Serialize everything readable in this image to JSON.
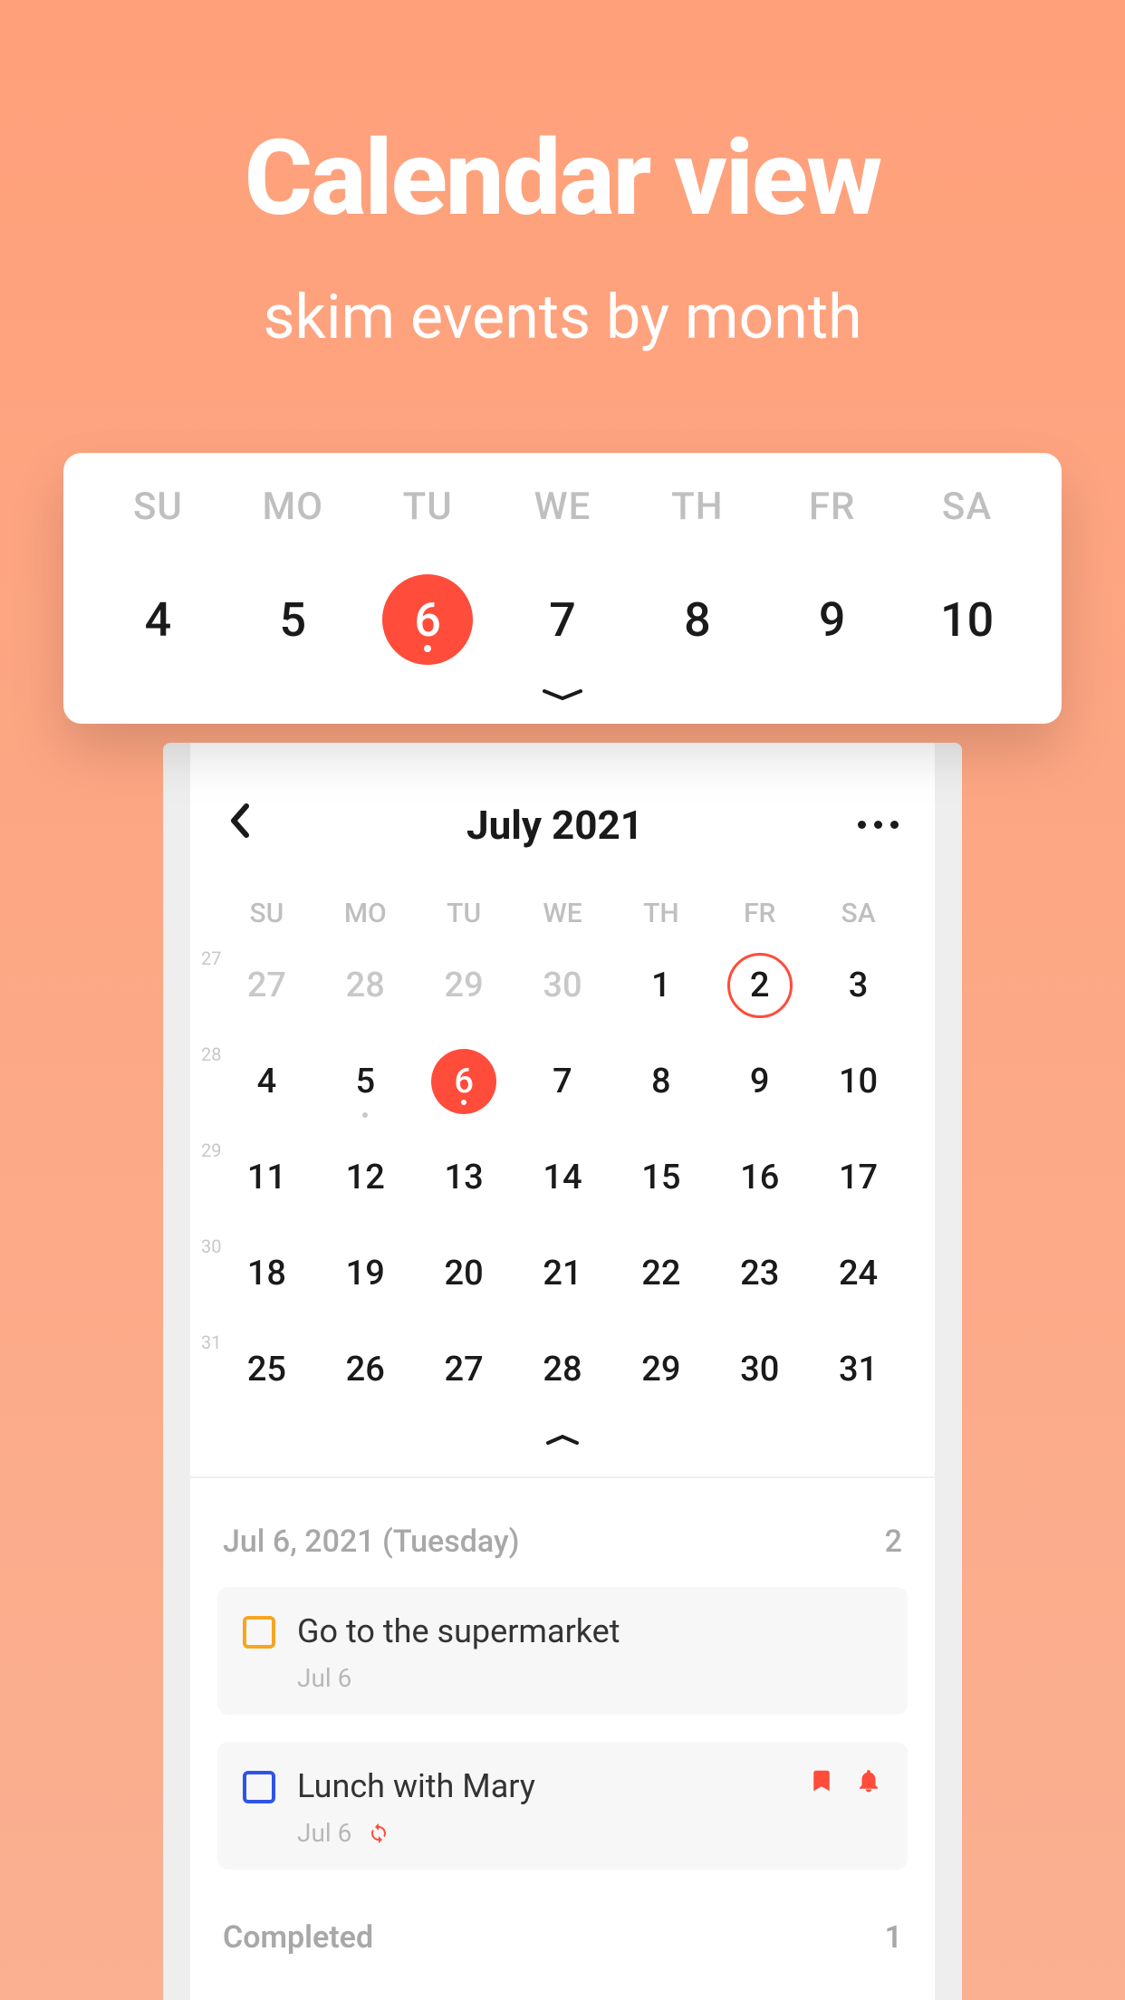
{
  "hero": {
    "title": "Calendar view",
    "subtitle": "skim events by month"
  },
  "week_card": {
    "dow": [
      "SU",
      "MO",
      "TU",
      "WE",
      "TH",
      "FR",
      "SA"
    ],
    "days": [
      {
        "n": "4"
      },
      {
        "n": "5"
      },
      {
        "n": "6",
        "today": true
      },
      {
        "n": "7"
      },
      {
        "n": "8"
      },
      {
        "n": "9"
      },
      {
        "n": "10"
      }
    ]
  },
  "month": {
    "title": "July 2021",
    "dow": [
      "SU",
      "MO",
      "TU",
      "WE",
      "TH",
      "FR",
      "SA"
    ],
    "weeks": [
      {
        "wn": "27",
        "cells": [
          {
            "n": "27",
            "dim": true
          },
          {
            "n": "28",
            "dim": true
          },
          {
            "n": "29",
            "dim": true
          },
          {
            "n": "30",
            "dim": true
          },
          {
            "n": "1"
          },
          {
            "n": "2",
            "ring": true
          },
          {
            "n": "3"
          }
        ]
      },
      {
        "wn": "28",
        "cells": [
          {
            "n": "4"
          },
          {
            "n": "5",
            "dot": true
          },
          {
            "n": "6",
            "today": true
          },
          {
            "n": "7"
          },
          {
            "n": "8"
          },
          {
            "n": "9"
          },
          {
            "n": "10"
          }
        ]
      },
      {
        "wn": "29",
        "cells": [
          {
            "n": "11"
          },
          {
            "n": "12"
          },
          {
            "n": "13"
          },
          {
            "n": "14"
          },
          {
            "n": "15"
          },
          {
            "n": "16"
          },
          {
            "n": "17"
          }
        ]
      },
      {
        "wn": "30",
        "cells": [
          {
            "n": "18"
          },
          {
            "n": "19"
          },
          {
            "n": "20"
          },
          {
            "n": "21"
          },
          {
            "n": "22"
          },
          {
            "n": "23"
          },
          {
            "n": "24"
          }
        ]
      },
      {
        "wn": "31",
        "cells": [
          {
            "n": "25"
          },
          {
            "n": "26"
          },
          {
            "n": "27"
          },
          {
            "n": "28"
          },
          {
            "n": "29"
          },
          {
            "n": "30"
          },
          {
            "n": "31"
          }
        ]
      }
    ]
  },
  "list": {
    "header_date": "Jul 6, 2021 (Tuesday)",
    "header_count": "2",
    "tasks": [
      {
        "cb": "orange",
        "title": "Go to the supermarket",
        "sub": "Jul 6",
        "repeat": false,
        "tag": false,
        "bell": false
      },
      {
        "cb": "blue",
        "title": "Lunch with Mary",
        "sub": "Jul 6",
        "repeat": true,
        "tag": true,
        "bell": true
      }
    ],
    "completed_label": "Completed",
    "completed_count": "1"
  }
}
